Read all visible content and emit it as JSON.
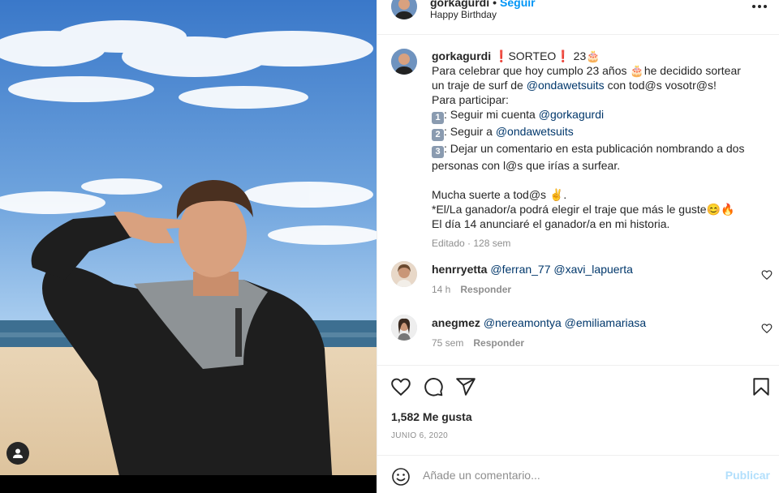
{
  "header": {
    "username": "gorkagurdi",
    "separator": "•",
    "follow_label": "Seguir",
    "subtitle": "Happy Birthday"
  },
  "caption": {
    "username": "gorkagurdi",
    "title_text": "SORTEO",
    "age": "23",
    "line1": "Para celebrar que hoy cumplo 23 años",
    "line1b": "he decidido sortear",
    "line2_pre": "un traje de surf de",
    "line2_mention": "@ondawetsuits",
    "line2_post": "con tod@s vosotr@s!",
    "line3": "Para participar:",
    "step1_pre": ": Seguir mi cuenta",
    "step1_mention": "@gorkagurdi",
    "step2_pre": ": Seguir a",
    "step2_mention": "@ondawetsuits",
    "step3": ": Dejar un comentario en esta publicación nombrando a dos",
    "step3b": "personas con l@s que irías a surfear.",
    "luck": "Mucha suerte a tod@s",
    "luck_end": ".",
    "note1": "*El/La ganador/a podrá elegir el traje que más le guste",
    "note2": "El día 14 anunciaré el ganador/a en mi historia.",
    "meta": "Editado · 128 sem",
    "step_numbers": [
      "1",
      "2",
      "3"
    ]
  },
  "comments": [
    {
      "username": "henrryetta",
      "mention1": "@ferran_77",
      "mention2": "@xavi_lapuerta",
      "time": "14 h",
      "reply": "Responder"
    },
    {
      "username": "anegmez",
      "mention1": "@nereamontya",
      "mention2": "@emiliamariasa",
      "time": "75 sem",
      "reply": "Responder"
    }
  ],
  "actions": {
    "likes": "1,582 Me gusta",
    "date": "JUNIO 6, 2020",
    "icons": [
      "heart-icon",
      "comment-icon",
      "share-icon",
      "bookmark-icon"
    ]
  },
  "add_comment": {
    "placeholder": "Añade un comentario...",
    "publish_label": "Publicar"
  },
  "colors": {
    "link_blue": "#0095f6",
    "mention": "#00376b",
    "muted": "#8e8e8e",
    "publish_disabled": "#b2dffc"
  }
}
